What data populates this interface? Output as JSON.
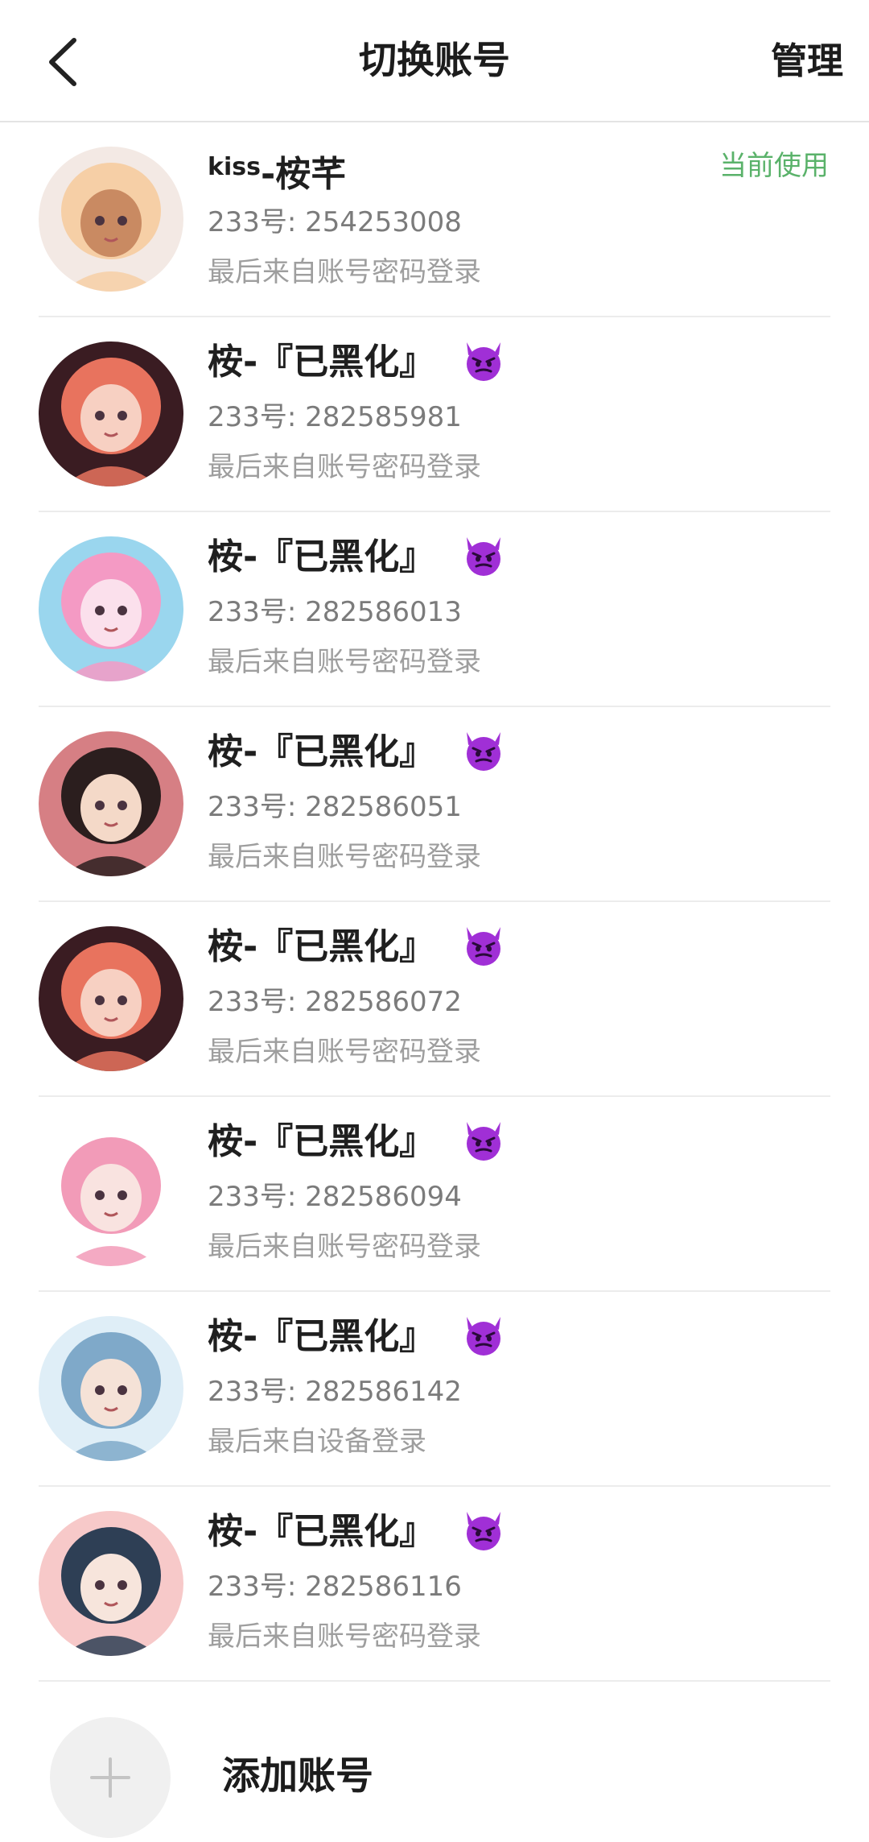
{
  "header": {
    "title": "切换账号",
    "manage_label": "管理"
  },
  "accounts": [
    {
      "name_prefix": "kiss",
      "name": "-桉芊",
      "uid": "233号: 254253008",
      "login": "最后来自账号密码登录",
      "status": "当前使用",
      "avatar_colors": [
        "#f3e9e4",
        "#f6cfa6",
        "#c98a62"
      ],
      "has_devil": false
    },
    {
      "name_prefix": "",
      "name": "桉-『已黑化』",
      "uid": "233号: 282585981",
      "login": "最后来自账号密码登录",
      "status": "",
      "avatar_colors": [
        "#3a1c22",
        "#e8735e",
        "#f7d0c2"
      ],
      "has_devil": true
    },
    {
      "name_prefix": "",
      "name": "桉-『已黑化』",
      "uid": "233号: 282586013",
      "login": "最后来自账号密码登录",
      "status": "",
      "avatar_colors": [
        "#9ad6ee",
        "#f49ac4",
        "#fbe0ec"
      ],
      "has_devil": true
    },
    {
      "name_prefix": "",
      "name": "桉-『已黑化』",
      "uid": "233号: 282586051",
      "login": "最后来自账号密码登录",
      "status": "",
      "avatar_colors": [
        "#d67f84",
        "#2b1e1e",
        "#f4d9c8"
      ],
      "has_devil": true
    },
    {
      "name_prefix": "",
      "name": "桉-『已黑化』",
      "uid": "233号: 282586072",
      "login": "最后来自账号密码登录",
      "status": "",
      "avatar_colors": [
        "#3a1c22",
        "#e8735e",
        "#f7d0c2"
      ],
      "has_devil": true
    },
    {
      "name_prefix": "",
      "name": "桉-『已黑化』",
      "uid": "233号: 282586094",
      "login": "最后来自账号密码登录",
      "status": "",
      "avatar_colors": [
        "#ffffff",
        "#f29bb8",
        "#f9e3e0"
      ],
      "has_devil": true
    },
    {
      "name_prefix": "",
      "name": "桉-『已黑化』",
      "uid": "233号: 282586142",
      "login": "最后来自设备登录",
      "status": "",
      "avatar_colors": [
        "#dfeef7",
        "#7fa9c9",
        "#f5e2d7"
      ],
      "has_devil": true
    },
    {
      "name_prefix": "",
      "name": "桉-『已黑化』",
      "uid": "233号: 282586116",
      "login": "最后来自账号密码登录",
      "status": "",
      "avatar_colors": [
        "#f7c9c9",
        "#2e3f55",
        "#f7e5dc"
      ],
      "has_devil": true
    }
  ],
  "add_account": {
    "label": "添加账号"
  },
  "colors": {
    "accent_green": "#5ab26a",
    "devil_purple": "#a02fd6"
  },
  "icons": {
    "back": "chevron-left-icon",
    "add": "plus-icon",
    "devil": "smiling-devil-emoji-icon"
  }
}
